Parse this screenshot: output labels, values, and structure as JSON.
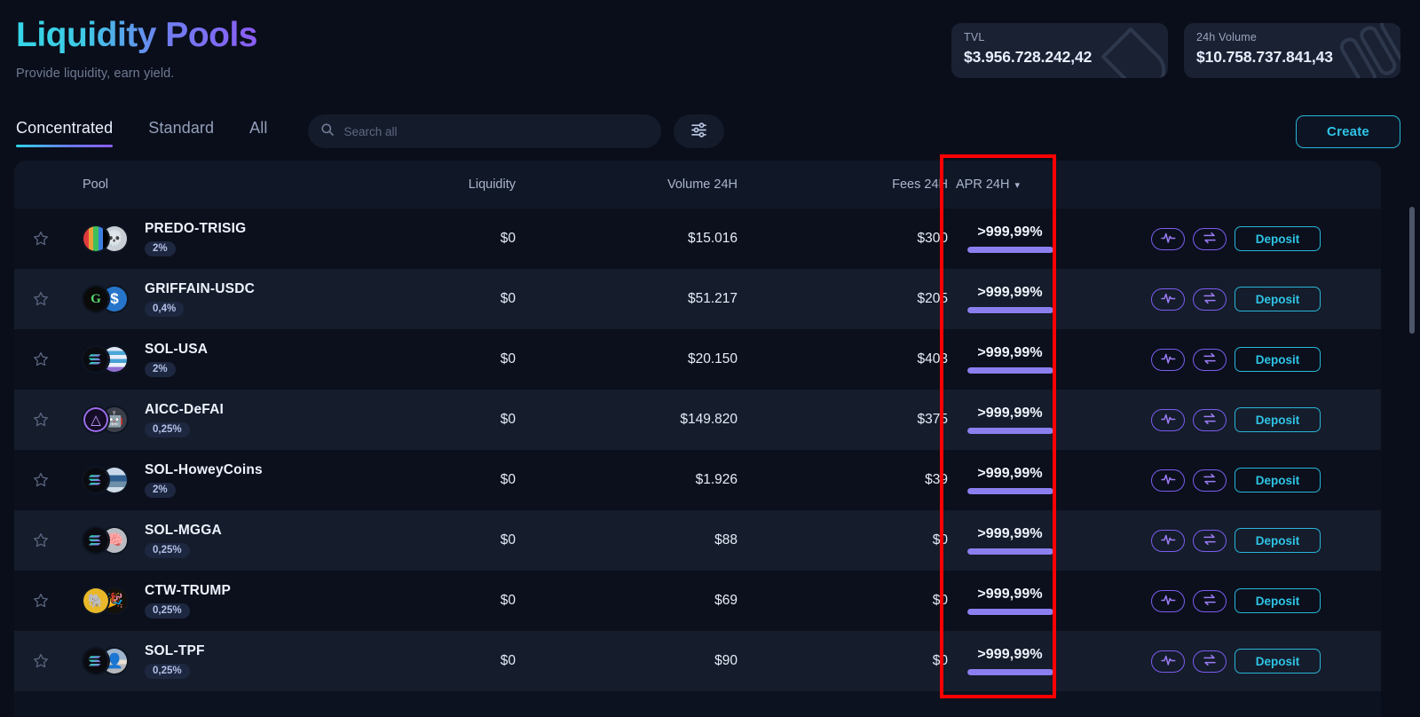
{
  "header": {
    "title": "Liquidity Pools",
    "subtitle": "Provide liquidity, earn yield."
  },
  "stats": [
    {
      "label": "TVL",
      "value": "$3.956.728.242,42",
      "icon": "liquidity-drop-icon"
    },
    {
      "label": "24h Volume",
      "value": "$10.758.737.841,43",
      "icon": "volume-bars-icon"
    }
  ],
  "toolbar": {
    "tabs": [
      {
        "label": "Concentrated",
        "active": true
      },
      {
        "label": "Standard",
        "active": false
      },
      {
        "label": "All",
        "active": false
      }
    ],
    "search": {
      "placeholder": "Search all",
      "value": ""
    },
    "filter_icon": "sliders-icon",
    "create_label": "Create"
  },
  "table": {
    "columns": {
      "pool": "Pool",
      "liquidity": "Liquidity",
      "volume": "Volume 24H",
      "fees": "Fees 24H",
      "apr": "APR 24H"
    },
    "sort": {
      "column": "APR 24H",
      "direction": "desc",
      "caret": "▾"
    },
    "rows": [
      {
        "name": "PREDO-TRISIG",
        "fee": "2%",
        "liquidity": "$0",
        "volume": "$15.016",
        "fees": "$300",
        "apr": ">999,99%",
        "apr_pct": 100,
        "deposit": "Deposit"
      },
      {
        "name": "GRIFFAIN-USDC",
        "fee": "0,4%",
        "liquidity": "$0",
        "volume": "$51.217",
        "fees": "$205",
        "apr": ">999,99%",
        "apr_pct": 100,
        "deposit": "Deposit"
      },
      {
        "name": "SOL-USA",
        "fee": "2%",
        "liquidity": "$0",
        "volume": "$20.150",
        "fees": "$403",
        "apr": ">999,99%",
        "apr_pct": 100,
        "deposit": "Deposit"
      },
      {
        "name": "AICC-DeFAI",
        "fee": "0,25%",
        "liquidity": "$0",
        "volume": "$149.820",
        "fees": "$375",
        "apr": ">999,99%",
        "apr_pct": 100,
        "deposit": "Deposit"
      },
      {
        "name": "SOL-HoweyCoins",
        "fee": "2%",
        "liquidity": "$0",
        "volume": "$1.926",
        "fees": "$39",
        "apr": ">999,99%",
        "apr_pct": 100,
        "deposit": "Deposit"
      },
      {
        "name": "SOL-MGGA",
        "fee": "0,25%",
        "liquidity": "$0",
        "volume": "$88",
        "fees": "$0",
        "apr": ">999,99%",
        "apr_pct": 100,
        "deposit": "Deposit"
      },
      {
        "name": "CTW-TRUMP",
        "fee": "0,25%",
        "liquidity": "$0",
        "volume": "$69",
        "fees": "$0",
        "apr": ">999,99%",
        "apr_pct": 100,
        "deposit": "Deposit"
      },
      {
        "name": "SOL-TPF",
        "fee": "0,25%",
        "liquidity": "$0",
        "volume": "$90",
        "fees": "$0",
        "apr": ">999,99%",
        "apr_pct": 100,
        "deposit": "Deposit"
      }
    ],
    "row_actions": {
      "chart_icon": "activity-chart-icon",
      "swap_icon": "swap-arrows-icon"
    }
  },
  "colors": {
    "accent_cyan": "#2ec4e6",
    "accent_purple": "#8b5cf6",
    "apr_bar": "#8b7ff0",
    "page_bg": "#0a0e1a",
    "row_bg": "#0b101c",
    "row_bg_alt": "#151c2b",
    "annotation": "#ff0000"
  },
  "annotation": {
    "shape": "rectangle",
    "target": "APR 24H column",
    "color": "#ff0000"
  }
}
